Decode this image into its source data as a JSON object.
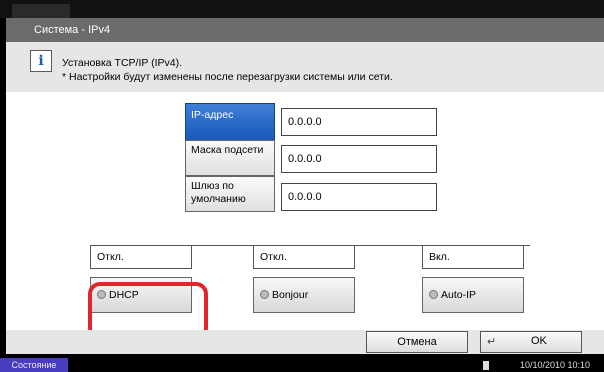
{
  "window": {
    "title": "Система - IPv4"
  },
  "info": {
    "icon": "info-icon",
    "line1": "Установка TCP/IP (IPv4).",
    "line2": "* Настройки будут изменены после перезагрузки системы или сети."
  },
  "fields": [
    {
      "label": "IP-адрес",
      "value": "0.0.0.0",
      "selected": true
    },
    {
      "label": "Маска подсети",
      "value": "0.0.0.0",
      "selected": false
    },
    {
      "label": "Шлюз по умолчанию",
      "value": "0.0.0.0",
      "selected": false
    }
  ],
  "options": [
    {
      "status": "Откл.",
      "label": "DHCP",
      "highlighted": true
    },
    {
      "status": "Откл.",
      "label": "Bonjour",
      "highlighted": false
    },
    {
      "status": "Вкл.",
      "label": "Auto-IP",
      "highlighted": false
    }
  ],
  "footer": {
    "cancel_label": "Отмена",
    "ok_label": "OK"
  },
  "statusbar": {
    "status_label": "Состояние",
    "datetime": "10/10/2010  10:10"
  },
  "colors": {
    "selected": "#1656b8",
    "highlight": "#e0262c",
    "status_button": "#4a3cc0"
  }
}
